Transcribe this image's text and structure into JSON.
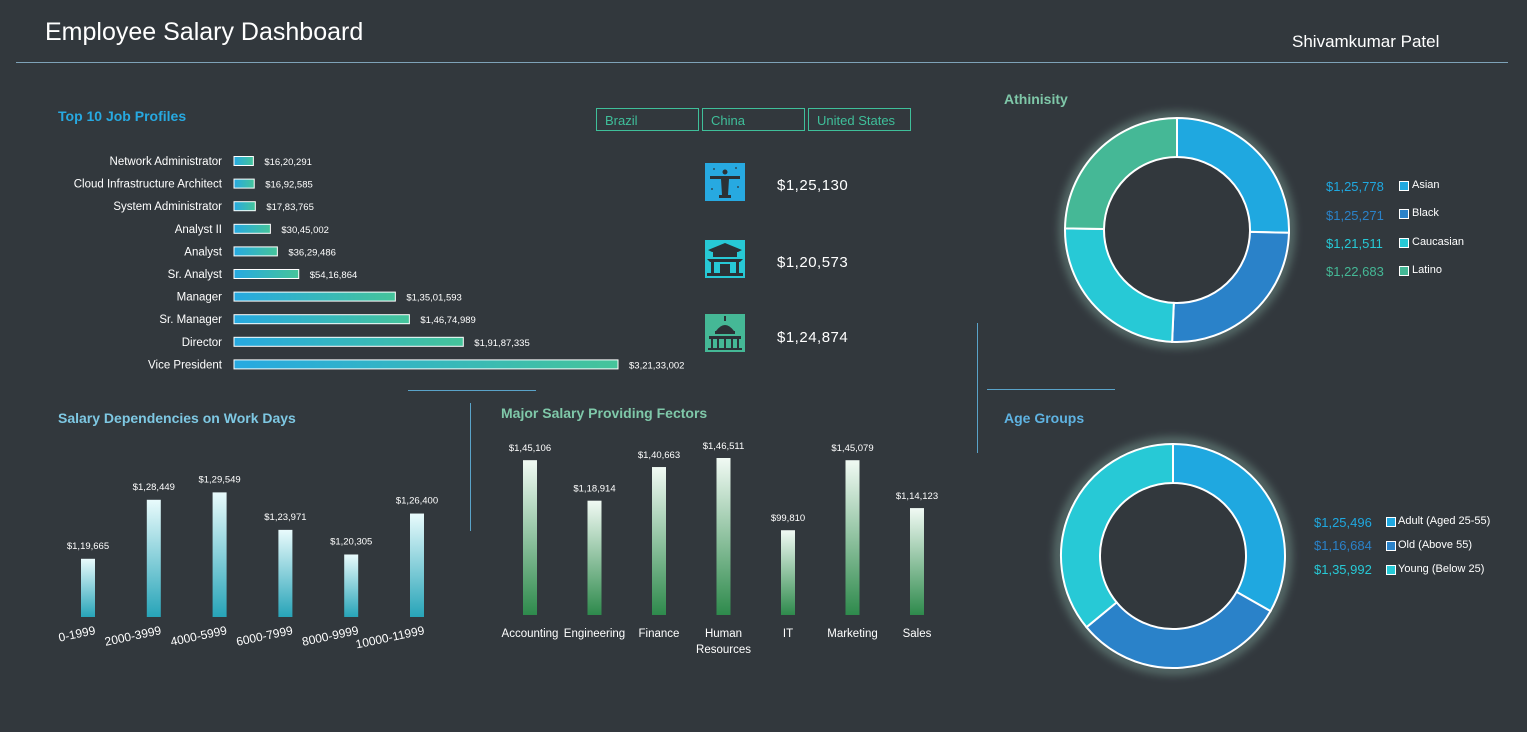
{
  "header": {
    "title": "Employee Salary Dashboard",
    "author": "Shivamkumar Patel"
  },
  "sections": {
    "top10": "Top 10 Job Profiles",
    "workdays": "Salary Dependencies on Work Days",
    "factors": "Major Salary Providing Fectors",
    "ethnicity": "Athinisity",
    "age": "Age Groups"
  },
  "slicers": [
    "Brazil",
    "China",
    "United States"
  ],
  "countries": [
    {
      "icon": "christ-the-redeemer-icon",
      "value": "$1,25,130"
    },
    {
      "icon": "chinese-temple-icon",
      "value": "$1,20,573"
    },
    {
      "icon": "capitol-building-icon",
      "value": "$1,24,874"
    }
  ],
  "colors": {
    "background": "#32383d",
    "accent_blue": "#27a9e1",
    "accent_green": "#3fbf9a",
    "donut_blue": "#1fa8e0",
    "donut_darkblue": "#2a82c9",
    "donut_cyan": "#27c9d6",
    "donut_green": "#45b896"
  },
  "chart_data": [
    {
      "id": "top10",
      "type": "bar",
      "orientation": "horizontal",
      "categories": [
        "Network Administrator",
        "Cloud Infrastructure Architect",
        "System Administrator",
        "Analyst II",
        "Analyst",
        "Sr. Analyst",
        "Manager",
        "Sr. Manager",
        "Director",
        "Vice President"
      ],
      "values": [
        1620291,
        1692585,
        1783765,
        3045002,
        3629486,
        5416864,
        13501593,
        14674989,
        19187335,
        32133002
      ],
      "labels": [
        "$16,20,291",
        "$16,92,585",
        "$17,83,765",
        "$30,45,002",
        "$36,29,486",
        "$54,16,864",
        "$1,35,01,593",
        "$1,46,74,989",
        "$1,91,87,335",
        "$3,21,33,002"
      ]
    },
    {
      "id": "workdays",
      "type": "bar",
      "categories": [
        "0-1999",
        "2000-3999",
        "4000-5999",
        "6000-7999",
        "8000-9999",
        "10000-11999"
      ],
      "values": [
        119665,
        128449,
        129549,
        123971,
        120305,
        126400
      ],
      "labels": [
        "$1,19,665",
        "$1,28,449",
        "$1,29,549",
        "$1,23,971",
        "$1,20,305",
        "$1,26,400"
      ]
    },
    {
      "id": "factors",
      "type": "bar",
      "categories": [
        "Accounting",
        "Engineering",
        "Finance",
        "Human Resources",
        "IT",
        "Marketing",
        "Sales"
      ],
      "values": [
        145106,
        118914,
        140663,
        146511,
        99810,
        145079,
        114123
      ],
      "labels": [
        "$1,45,106",
        "$1,18,914",
        "$1,40,663",
        "$1,46,511",
        "$99,810",
        "$1,45,079",
        "$1,14,123"
      ]
    },
    {
      "id": "ethnicity",
      "type": "pie",
      "categories": [
        "Asian",
        "Black",
        "Caucasian",
        "Latino"
      ],
      "values": [
        125778,
        125271,
        121511,
        122683
      ],
      "labels": [
        "$1,25,778",
        "$1,25,271",
        "$1,21,511",
        "$1,22,683"
      ],
      "colors": [
        "#1fa8e0",
        "#2a82c9",
        "#27c9d6",
        "#45b896"
      ]
    },
    {
      "id": "age",
      "type": "pie",
      "categories": [
        "Adult (Aged 25-55)",
        "Old (Above 55)",
        "Young (Below 25)"
      ],
      "values": [
        125496,
        116684,
        135992
      ],
      "labels": [
        "$1,25,496",
        "$1,16,684",
        "$1,35,992"
      ],
      "colors": [
        "#1fa8e0",
        "#2a82c9",
        "#27c9d6"
      ]
    }
  ]
}
